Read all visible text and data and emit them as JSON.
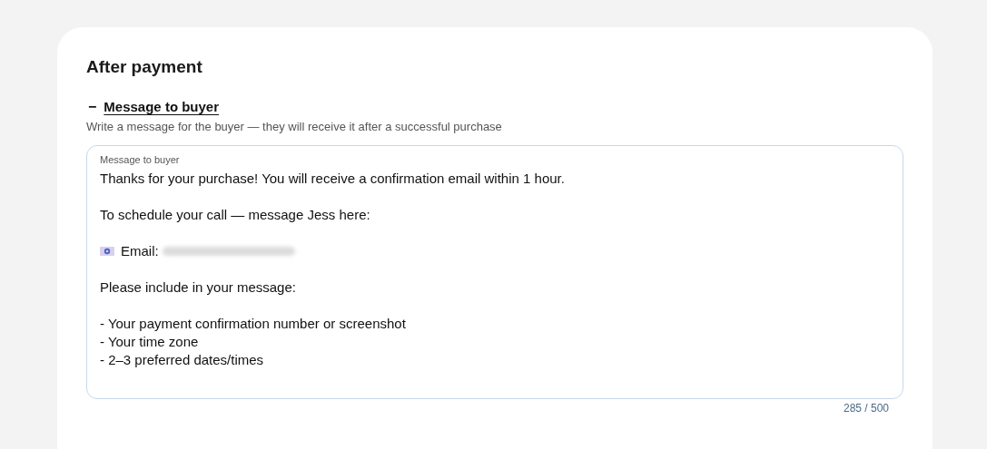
{
  "section_title": "After payment",
  "collapse_toggle": {
    "symbol": "−",
    "expanded": true
  },
  "heading": "Message to buyer",
  "hint": "Write a message for the buyer — they will receive it after a successful purchase",
  "message_field": {
    "label": "Message to buyer",
    "lines": [
      {
        "kind": "text",
        "text": "Thanks for your purchase! You will receive a confirmation email within 1 hour."
      },
      {
        "kind": "gap"
      },
      {
        "kind": "text",
        "text": "To schedule your call — message Jess here:"
      },
      {
        "kind": "gap"
      },
      {
        "kind": "email",
        "text": "Email:"
      },
      {
        "kind": "gap"
      },
      {
        "kind": "text",
        "text": "Please include in your message:"
      },
      {
        "kind": "gap"
      },
      {
        "kind": "text",
        "text": "- Your payment confirmation number or screenshot"
      },
      {
        "kind": "text",
        "text": "- Your time zone"
      },
      {
        "kind": "text",
        "text": "- 2–3 preferred dates/times"
      }
    ]
  },
  "char_count": "285 / 500"
}
